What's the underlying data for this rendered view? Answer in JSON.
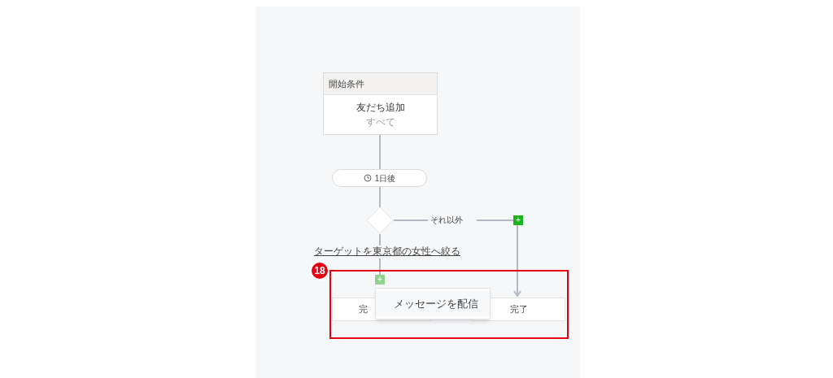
{
  "start_node": {
    "header": "開始条件",
    "title": "友だち追加",
    "subtitle": "すべて"
  },
  "delay": {
    "label": "1日後"
  },
  "branch": {
    "else_label": "それ以外",
    "condition_label": "ターゲットを東京都の女性へ絞る"
  },
  "add_buttons": [
    {
      "symbol": "+",
      "disabled": false
    },
    {
      "symbol": "+",
      "disabled": true
    }
  ],
  "end_nodes": [
    {
      "label": "完"
    },
    {
      "label": "完了"
    }
  ],
  "popup_menu": {
    "items": [
      "メッセージを配信"
    ]
  },
  "annotation": {
    "number": "18"
  }
}
